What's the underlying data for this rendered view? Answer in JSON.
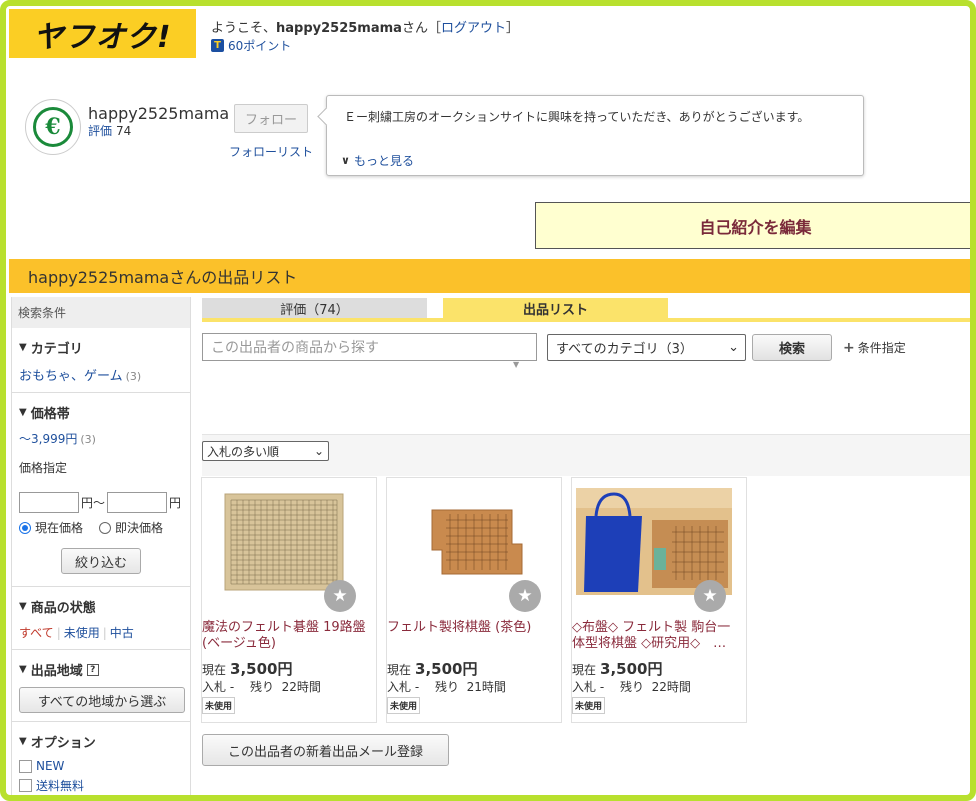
{
  "header": {
    "logo_text": "ヤフオク!",
    "welcome_prefix": "ようこそ、",
    "welcome_user": "happy2525mama",
    "welcome_suffix": "さん［",
    "logout_label": "ログアウト",
    "welcome_close": "］",
    "points": "60ポイント",
    "points_icon": "t-point-icon"
  },
  "profile": {
    "avatar_letter": "€",
    "username": "happy2525mama",
    "rating_label": "評価",
    "rating_value": "74",
    "follow_button": "フォロー",
    "follow_list": "フォローリスト",
    "bio_text": "Ｅー刺繍工房のオークションサイトに興味を持っていただき、ありがとうございます。",
    "bio_more": "もっと見る",
    "edit_intro": "自己紹介を編集"
  },
  "section_title": "happy2525mamaさんの出品リスト",
  "sidebar": {
    "header": "検索条件",
    "category_title": "カテゴリ",
    "category_item": "おもちゃ、ゲーム",
    "category_count": "(3)",
    "price_title": "価格帯",
    "price_range": "～3,999円",
    "price_count": "(3)",
    "price_spec": "価格指定",
    "price_unit_from": "円～",
    "price_unit_to": "円",
    "radio_current": "現在価格",
    "radio_buynow": "即決価格",
    "narrow_button": "絞り込む",
    "condition_title": "商品の状態",
    "condition_all": "すべて",
    "condition_unused": "未使用",
    "condition_used": "中古",
    "region_title": "出品地域",
    "region_button": "すべての地域から選ぶ",
    "option_title": "オプション",
    "option_new": "NEW",
    "option_free_shipping": "送料無料"
  },
  "tabs": {
    "rating": "評価（74）",
    "listing": "出品リスト"
  },
  "search": {
    "placeholder": "この出品者の商品から探す",
    "category_select": "すべてのカテゴリ（3）",
    "search_button": "検索",
    "condition_spec": "条件指定"
  },
  "sort": {
    "selected": "入札の多い順"
  },
  "products": [
    {
      "title": "魔法のフェルト碁盤 19路盤 (ベージュ色)",
      "price_label": "現在",
      "price": "3,500円",
      "bid_line": "入札 -　 残り  22時間",
      "badge": "未使用"
    },
    {
      "title": "フェルト製将棋盤 (茶色)",
      "price_label": "現在",
      "price": "3,500円",
      "bid_line": "入札 -　 残り  21時間",
      "badge": "未使用"
    },
    {
      "title": "◇布盤◇ フェルト製 駒台一体型将棋盤 ◇研究用◇　…",
      "price_label": "現在",
      "price": "3,500円",
      "bid_line": "入札 -　 残り  22時間",
      "badge": "未使用"
    }
  ],
  "mail_button": "この出品者の新着出品メール登録",
  "colors": {
    "frame": "#b8e02e",
    "brand_yellow": "#fbce24",
    "link_blue": "#1e4f9c",
    "title_red": "#8a2b3c"
  }
}
